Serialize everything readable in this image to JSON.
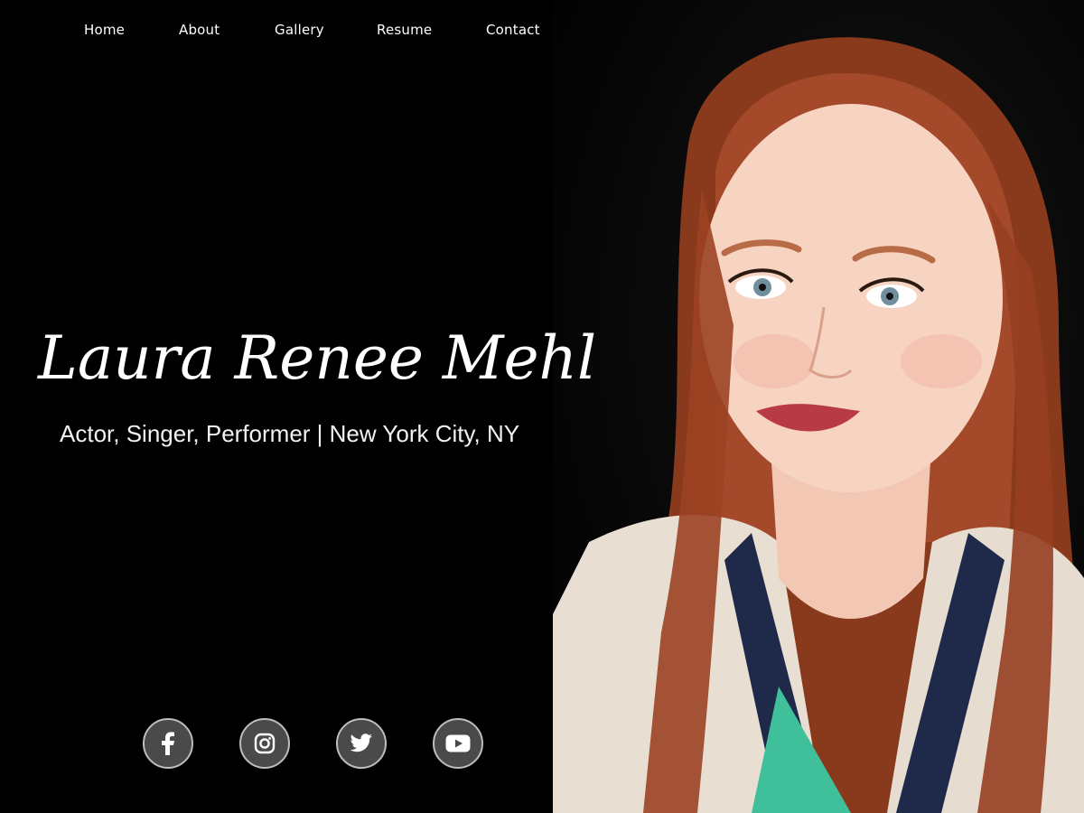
{
  "nav": {
    "items": [
      {
        "label": "Home"
      },
      {
        "label": "About"
      },
      {
        "label": "Gallery"
      },
      {
        "label": "Resume"
      },
      {
        "label": "Contact"
      }
    ]
  },
  "hero": {
    "name": "Laura Renee Mehl",
    "tagline": "Actor, Singer, Performer | New York City, NY"
  },
  "social": [
    {
      "icon": "facebook-icon"
    },
    {
      "icon": "instagram-icon"
    },
    {
      "icon": "twitter-icon"
    },
    {
      "icon": "youtube-icon"
    }
  ],
  "colors": {
    "background": "#000000",
    "text": "#ffffff",
    "social_circle": "#4a4a4a",
    "social_border": "#bdbdbd"
  }
}
